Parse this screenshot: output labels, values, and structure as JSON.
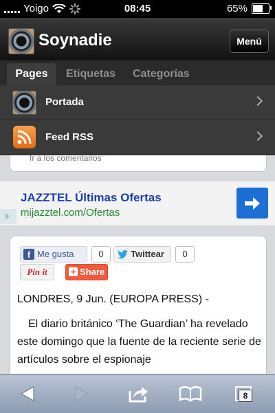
{
  "status_bar": {
    "carrier": "Yoigo",
    "time": "08:45",
    "battery": "65%",
    "battery_level": 0.65
  },
  "header": {
    "site_title": "Soynadie",
    "menu_button": "Menú"
  },
  "tabs": [
    {
      "label": "Pages",
      "active": true
    },
    {
      "label": "Etiquetas",
      "active": false
    },
    {
      "label": "Categorías",
      "active": false
    }
  ],
  "menu_items": [
    {
      "label": "Portada",
      "icon": "avatar-icon"
    },
    {
      "label": "Feed RSS",
      "icon": "rss-icon"
    }
  ],
  "partial_link": "Ir a los comentarios",
  "ad": {
    "title": "JAZZTEL Últimas Ofertas",
    "url": "mijazztel.com/Ofertas"
  },
  "social": {
    "like_label": "Me gusta",
    "like_count": "0",
    "tweet_label": "Twittear",
    "tweet_count": "0",
    "pin_label": "Pin it",
    "share_label": "Share"
  },
  "article": {
    "dateline": "LONDRES, 9 Jun. (EUROPA PRESS) -",
    "body": "El diario británico ‘The Guardian’ ha revelado este domingo que la fuente de la reciente serie de artículos sobre el espionaje"
  },
  "toolbar": {
    "tab_count": "8"
  },
  "colors": {
    "ad_title": "#1a3fb3",
    "ad_url": "#218a2f",
    "ad_arrow": "#1d6fd6",
    "share": "#f15a3b"
  }
}
